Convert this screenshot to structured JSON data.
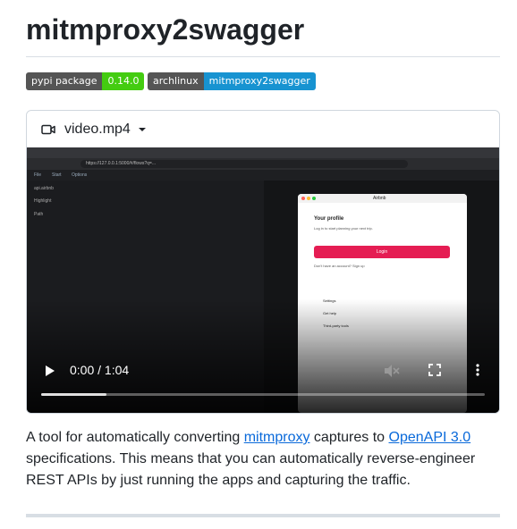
{
  "title": "mitmproxy2swagger",
  "badges": [
    {
      "label": "pypi package",
      "value": "0.14.0",
      "color": "#44cc11"
    },
    {
      "label": "archlinux",
      "value": "mitmproxy2swagger",
      "color": "#1793d1"
    }
  ],
  "video": {
    "filename": "video.mp4",
    "time_display": "0:00 / 1:04",
    "progress_buffered": 0.15,
    "inner": {
      "url": "https://127.0.0.1:5000/#/flows?q=...",
      "tabs": [
        "File",
        "Start",
        "Options"
      ],
      "side_rows": [
        "api.airbnb",
        "Highlight",
        "Path"
      ],
      "airbnb_title": "Airbnb",
      "profile_heading": "Your profile",
      "profile_sub": "Log in to start planning your next trip.",
      "login_label": "Login",
      "signup_text": "Don't have an account? Sign up",
      "menu": [
        "Settings",
        "Get help",
        "Third-party tools"
      ]
    }
  },
  "description": {
    "part1": "A tool for automatically converting ",
    "link1": "mitmproxy",
    "part2": " captures to ",
    "link2": "OpenAPI 3.0",
    "part3": " specifications. This means that you can automatically reverse-engineer REST APIs by just running the apps and capturing the traffic."
  }
}
